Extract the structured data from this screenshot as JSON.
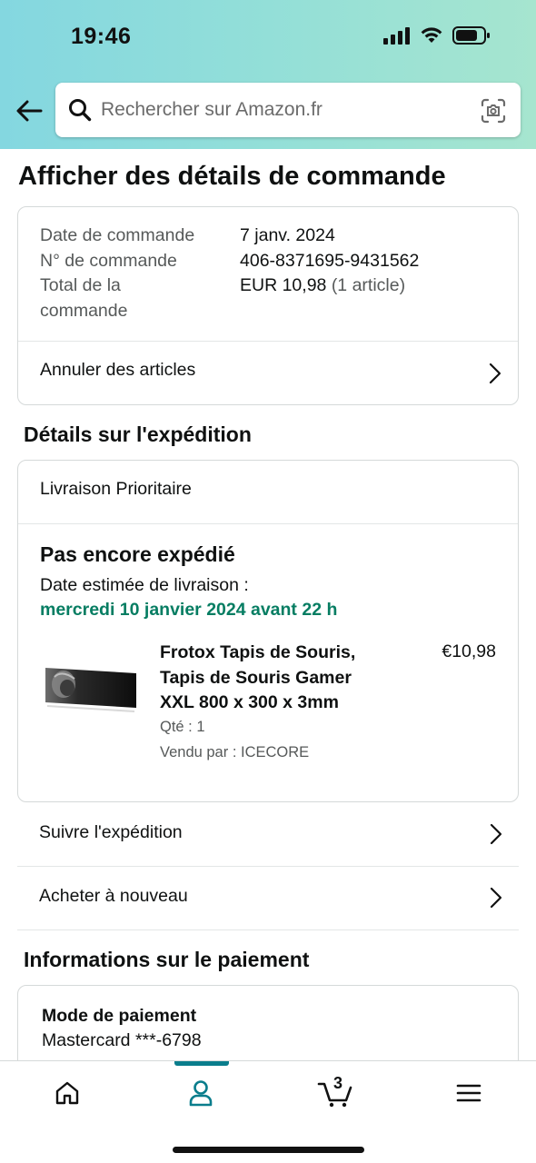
{
  "status_bar": {
    "time": "19:46"
  },
  "search": {
    "placeholder": "Rechercher sur Amazon.fr"
  },
  "page": {
    "title": "Afficher des détails de commande"
  },
  "summary": {
    "order_date_label": "Date de commande",
    "order_date_value": "7 janv. 2024",
    "order_number_label": "N° de commande",
    "order_number_value": "406-8371695-9431562",
    "order_total_label_line1": "Total de la",
    "order_total_label_line2": "commande",
    "order_total_value": "EUR 10,98",
    "order_total_items": "(1 article)",
    "cancel_label": "Annuler des articles"
  },
  "shipping": {
    "section_title": "Détails sur l'expédition",
    "method": "Livraison Prioritaire",
    "status": "Pas encore expédié",
    "estimated_label": "Date estimée de livraison :",
    "estimated_date": "mercredi 10 janvier 2024 avant 22 h",
    "product": {
      "title": "Frotox Tapis de Souris, Tapis de Souris Gamer XXL 800 x 300 x 3mm",
      "price": "€10,98",
      "quantity": "Qté : 1",
      "seller": "Vendu par : ICECORE"
    },
    "track_label": "Suivre l'expédition",
    "buy_again_label": "Acheter à nouveau"
  },
  "payment": {
    "section_title": "Informations sur le paiement",
    "method_title": "Mode de paiement",
    "method_value": "Mastercard ***-6798"
  },
  "tabbar": {
    "cart_count": "3",
    "active_tab": "account",
    "accent_color": "#0a7d8c"
  },
  "colors": {
    "delivery_green": "#067d62",
    "header_gradient_start": "#84d7e0",
    "header_gradient_end": "#a6e5cf"
  }
}
